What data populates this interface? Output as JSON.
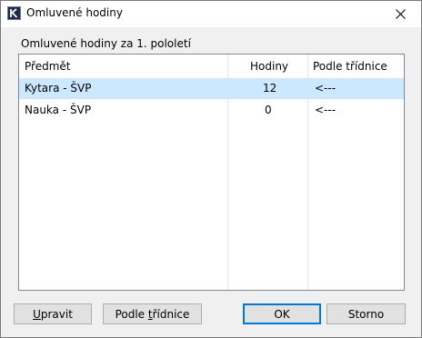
{
  "window": {
    "title": "Omluvené hodiny",
    "icon": "k-app-icon",
    "close_icon": "close-icon"
  },
  "group": {
    "label": "Omluvené hodiny za 1. pololetí"
  },
  "table": {
    "columns": [
      "Předmět",
      "Hodiny",
      "Podle třídnice"
    ],
    "rows": [
      {
        "subject": "Kytara - ŠVP",
        "hours": "12",
        "per_register": "<---",
        "selected": true
      },
      {
        "subject": "Nauka - ŠVP",
        "hours": "0",
        "per_register": "<---",
        "selected": false
      }
    ]
  },
  "buttons": {
    "edit": {
      "mnemonic": "U",
      "rest": "pravit"
    },
    "by_register": {
      "prefix": "Podle ",
      "mnemonic": "t",
      "rest": "řídnice"
    },
    "ok": "OK",
    "cancel": "Storno"
  },
  "colors": {
    "selection": "#cce8ff",
    "default_button_border": "#0078d7"
  }
}
